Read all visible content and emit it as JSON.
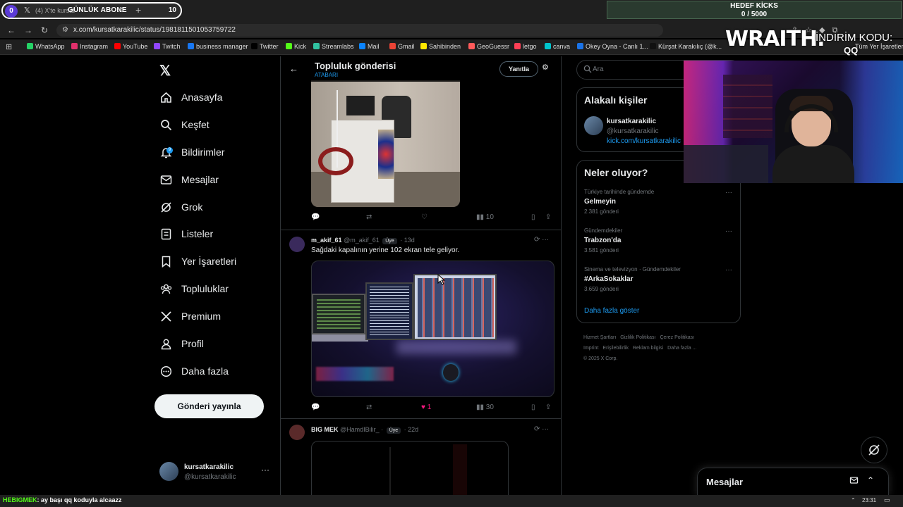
{
  "browser": {
    "tab_counter_badge": "0",
    "tab_title": "(4) X'te kursat",
    "overlay_abone": "GÜNLÜK ABONE",
    "tab_group_count": "10",
    "url": "x.com/kursatkarakilic/status/1981811501053759722",
    "bookmarks": [
      {
        "label": "WhatsApp",
        "color": "#25d366"
      },
      {
        "label": "Instagram",
        "color": "#e1306c"
      },
      {
        "label": "YouTube",
        "color": "#ff0000"
      },
      {
        "label": "Twitch",
        "color": "#9146ff"
      },
      {
        "label": "business manager",
        "color": "#1877f2"
      },
      {
        "label": "Twitter",
        "color": "#000000"
      },
      {
        "label": "Kick",
        "color": "#53fc18"
      },
      {
        "label": "Streamlabs",
        "color": "#31c3a2"
      },
      {
        "label": "Mail",
        "color": "#0a84ff"
      },
      {
        "label": "Gmail",
        "color": "#ea4335"
      },
      {
        "label": "Sahibinden",
        "color": "#ffe800"
      },
      {
        "label": "GeoGuessr",
        "color": "#ff5a5a"
      },
      {
        "label": "letgo",
        "color": "#ff3f55"
      },
      {
        "label": "canva",
        "color": "#00c4cc"
      },
      {
        "label": "Okey Oyna - Canlı 1...",
        "color": "#1a73e8"
      },
      {
        "label": "Kürşat Karakılıç (@k...",
        "color": "#111111"
      }
    ],
    "bookmarks_more": "Tüm Yer İşaretleri"
  },
  "overlay": {
    "hedef_title": "HEDEF KİCKS",
    "hedef_progress": "0 / 5000",
    "brand": "WRAITH.",
    "indirim": "İNDİRİM KODU:",
    "code": "QQ"
  },
  "nav": {
    "items": [
      {
        "label": "Anasayfa",
        "icon": "home-icon"
      },
      {
        "label": "Keşfet",
        "icon": "search-icon"
      },
      {
        "label": "Bildirimler",
        "icon": "bell-icon"
      },
      {
        "label": "Mesajlar",
        "icon": "mail-icon"
      },
      {
        "label": "Grok",
        "icon": "grok-icon"
      },
      {
        "label": "Listeler",
        "icon": "list-icon"
      },
      {
        "label": "Yer İşaretleri",
        "icon": "bookmark-icon"
      },
      {
        "label": "Topluluklar",
        "icon": "communities-icon"
      },
      {
        "label": "Premium",
        "icon": "x-icon"
      },
      {
        "label": "Profil",
        "icon": "profile-icon"
      },
      {
        "label": "Daha fazla",
        "icon": "more-circle-icon"
      }
    ],
    "post_button": "Gönderi yayınla",
    "account": {
      "name": "kursatkarakilic",
      "handle": "@kursatkarakilic",
      "more": "···"
    },
    "notification_badge": "9"
  },
  "center": {
    "header_title": "Topluluk gönderisi",
    "header_sub": "ATABARI",
    "reply_button": "Yanıtla",
    "post0": {
      "views": "10"
    },
    "post1": {
      "name": "m_akif_61",
      "handle": "@m_akif_61",
      "badge": "Üye",
      "time": "· 13d",
      "text": "Sağdaki kapalının yerine 102 ekran tele geliyor.",
      "likes": "1",
      "views": "30"
    },
    "post2": {
      "name": "BIG MEK",
      "handle": "@HamdIBilir_ ·",
      "badge": "Üye",
      "time": "· 22d"
    }
  },
  "right": {
    "search_placeholder": "Ara",
    "related_title": "Alakalı kişiler",
    "related": {
      "name": "kursatkarakilic",
      "handle": "@kursatkarakilic",
      "link": "kick.com/kursatkarakilic"
    },
    "trends_title": "Neler oluyor?",
    "trends": [
      {
        "context": "Türkiye tarihinde gündemde",
        "name": "Gelmeyin",
        "count": "2.381 gönderi"
      },
      {
        "context": "Gündemdekiler",
        "name": "Trabzon'da",
        "count": "3.581 gönderi"
      },
      {
        "context": "Sinema ve televizyon · Gündemdekiler",
        "name": "#ArkaSokaklar",
        "count": "3.659 gönderi"
      }
    ],
    "show_more": "Daha fazla göster",
    "footer": [
      "Hizmet Şartları",
      "Gizlilik Politikası",
      "Çerez Politikası",
      "Imprint",
      "Erişilebilirlik",
      "Reklam bilgisi",
      "Daha fazla ...",
      "© 2025 X Corp."
    ]
  },
  "messages_bar": {
    "title": "Mesajlar"
  },
  "taskbar": {
    "chat_user": "HEBIGMEK",
    "chat_message": ": ay başı qq koduyla alcaazz",
    "time": "23:31"
  }
}
